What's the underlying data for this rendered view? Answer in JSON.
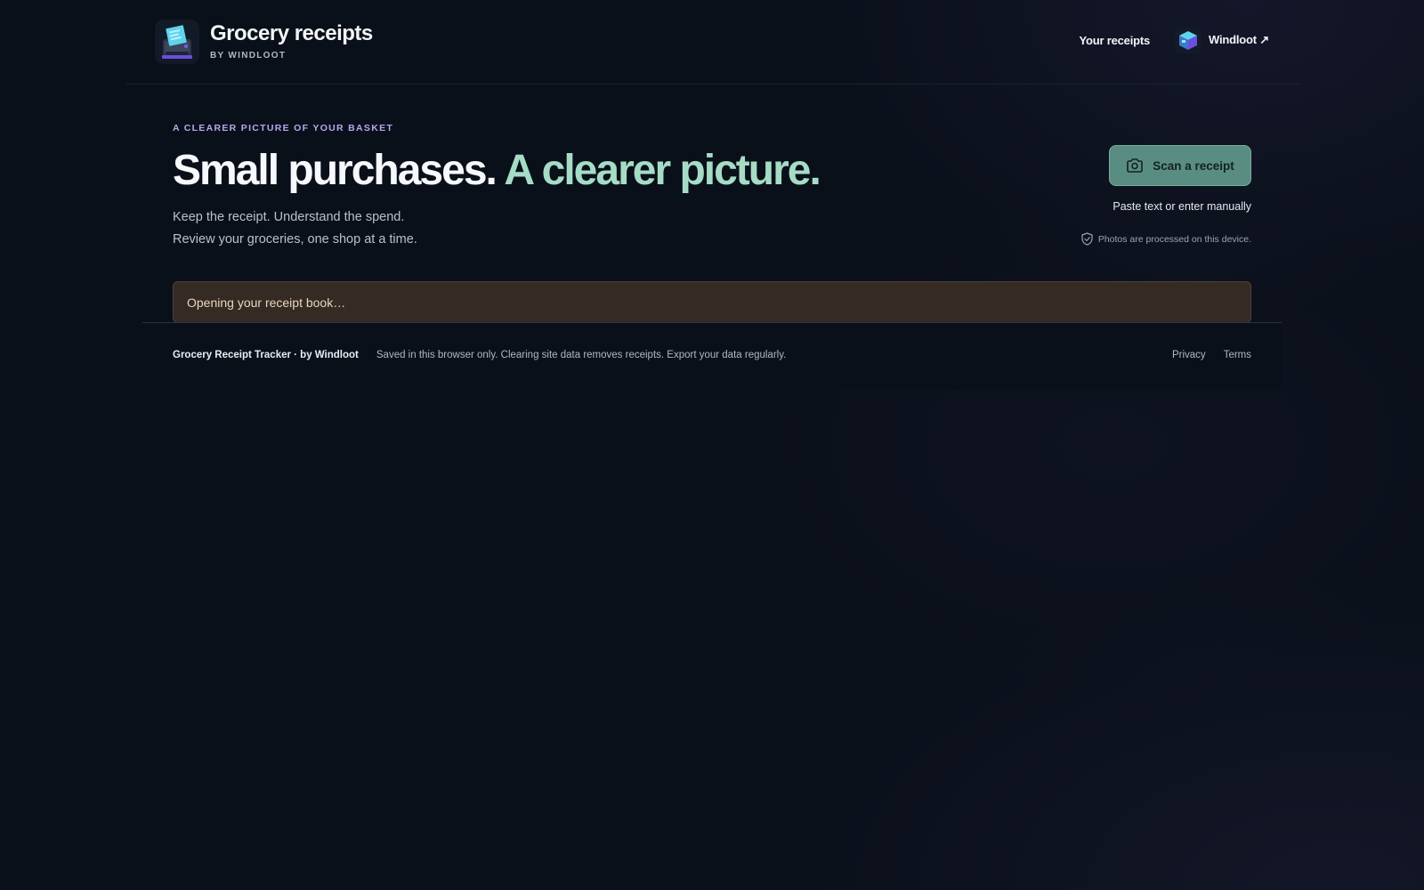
{
  "header": {
    "title": "Grocery receipts",
    "subtitle": "BY WINDLOOT",
    "nav": {
      "your_receipts": "Your receipts",
      "windloot": "Windloot ↗"
    }
  },
  "hero": {
    "eyebrow": "A CLEARER PICTURE OF YOUR BASKET",
    "headline_main": "Small purchases.",
    "headline_accent": "A clearer picture.",
    "lede_line1": "Keep the receipt. Understand the spend.",
    "lede_line2": "Review your groceries, one shop at a time."
  },
  "actions": {
    "scan_label": "Scan a receipt",
    "manual_label": "Paste text or enter manually",
    "privacy_note": "Photos are processed on this device."
  },
  "status": {
    "loading_text": "Opening your receipt book…"
  },
  "footer": {
    "brand": "Grocery Receipt Tracker · by Windloot",
    "note": "Saved in this browser only. Clearing site data removes receipts. Export your data regularly.",
    "privacy": "Privacy",
    "terms": "Terms"
  },
  "icons": {
    "app_logo": "receipt-printer-icon",
    "windloot_logo": "windloot-cube-icon",
    "scan": "camera-icon",
    "privacy": "shield-check-icon"
  },
  "colors": {
    "background": "#0a101a",
    "accent_green": "#a6dcc6",
    "eyebrow_purple": "#b9a6ee",
    "scan_button": "#5a8d81",
    "loading_bg": "#352a24"
  }
}
